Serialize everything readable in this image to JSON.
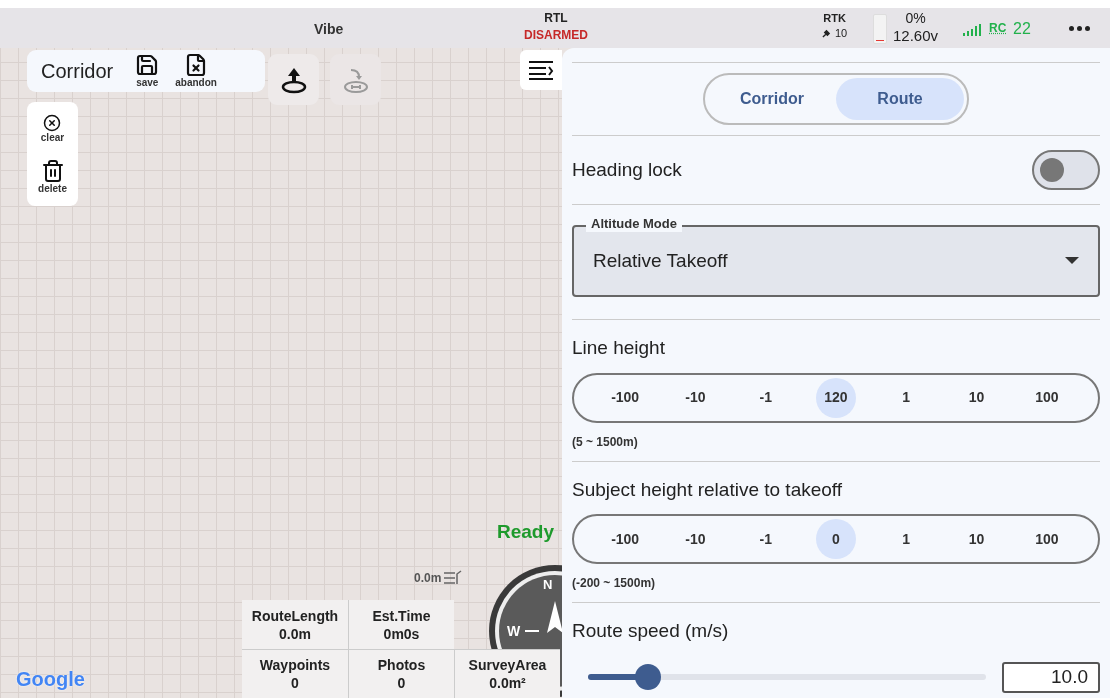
{
  "status_bar": {
    "title": "Vibe",
    "mode": "RTL",
    "arm_state": "DISARMED",
    "rtk": {
      "label": "RTK",
      "satellites": "10"
    },
    "battery": {
      "percent": "0%",
      "voltage": "12.60v",
      "level": 0.05
    },
    "rc": {
      "label": "RC",
      "value": "22"
    }
  },
  "map": {
    "mission_card": {
      "title": "Corridor",
      "actions": [
        {
          "kind": "save",
          "label": "save"
        },
        {
          "kind": "abandon",
          "label": "abandon"
        }
      ]
    },
    "tools": [
      {
        "kind": "upload",
        "disabled": false
      },
      {
        "kind": "home",
        "disabled": true
      }
    ],
    "side_actions": [
      {
        "kind": "clear",
        "label": "clear"
      },
      {
        "kind": "delete",
        "label": "delete"
      }
    ],
    "status": "Ready",
    "telemetry": "0.0m",
    "compass": {
      "north": "N",
      "west": "W"
    },
    "stats_rows": [
      [
        {
          "label": "RouteLength",
          "value": "0.0m"
        },
        {
          "label": "Est.Time",
          "value": "0m0s"
        }
      ],
      [
        {
          "label": "Waypoints",
          "value": "0"
        },
        {
          "label": "Photos",
          "value": "0"
        },
        {
          "label": "SurveyArea",
          "value": "0.0m²"
        }
      ]
    ],
    "attribution": "Google"
  },
  "panel": {
    "tabs": [
      {
        "label": "Corridor",
        "selected": false
      },
      {
        "label": "Route",
        "selected": true
      }
    ],
    "heading_lock": {
      "label": "Heading lock",
      "on": false
    },
    "altitude_mode": {
      "label": "Altitude Mode",
      "value": "Relative Takeoff"
    },
    "steppers": [
      {
        "label": "Line height",
        "range": "(5 ~ 1500m)",
        "steps": [
          {
            "text": "-100",
            "selected": false
          },
          {
            "text": "-10",
            "selected": false
          },
          {
            "text": "-1",
            "selected": false
          },
          {
            "text": "120",
            "selected": true
          },
          {
            "text": "1",
            "selected": false
          },
          {
            "text": "10",
            "selected": false
          },
          {
            "text": "100",
            "selected": false
          }
        ]
      },
      {
        "label": "Subject height relative to takeoff",
        "range": "(-200 ~ 1500m)",
        "steps": [
          {
            "text": "-100",
            "selected": false
          },
          {
            "text": "-10",
            "selected": false
          },
          {
            "text": "-1",
            "selected": false
          },
          {
            "text": "0",
            "selected": true
          },
          {
            "text": "1",
            "selected": false
          },
          {
            "text": "10",
            "selected": false
          },
          {
            "text": "100",
            "selected": false
          }
        ]
      }
    ],
    "route_speed": {
      "label": "Route speed (m/s)",
      "level": 0.15,
      "value": "10.0"
    }
  }
}
